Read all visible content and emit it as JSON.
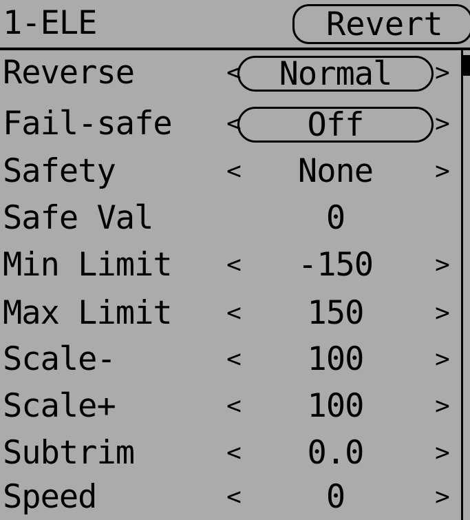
{
  "header": {
    "title": "1-ELE",
    "revert_label": "Revert"
  },
  "arrows": {
    "left": "<",
    "right": ">"
  },
  "rows": [
    {
      "label": "Reverse",
      "value": "Normal"
    },
    {
      "label": "Fail-safe",
      "value": "Off"
    },
    {
      "label": "Safety",
      "value": "None"
    },
    {
      "label": "Safe Val",
      "value": "0"
    },
    {
      "label": "Min Limit",
      "value": "-150"
    },
    {
      "label": "Max Limit",
      "value": "150"
    },
    {
      "label": "Scale-",
      "value": "100"
    },
    {
      "label": "Scale+",
      "value": "100"
    },
    {
      "label": "Subtrim",
      "value": "0.0"
    },
    {
      "label": "Speed",
      "value": "0"
    }
  ],
  "colors": {
    "background": "#ababab",
    "foreground": "#000000"
  }
}
